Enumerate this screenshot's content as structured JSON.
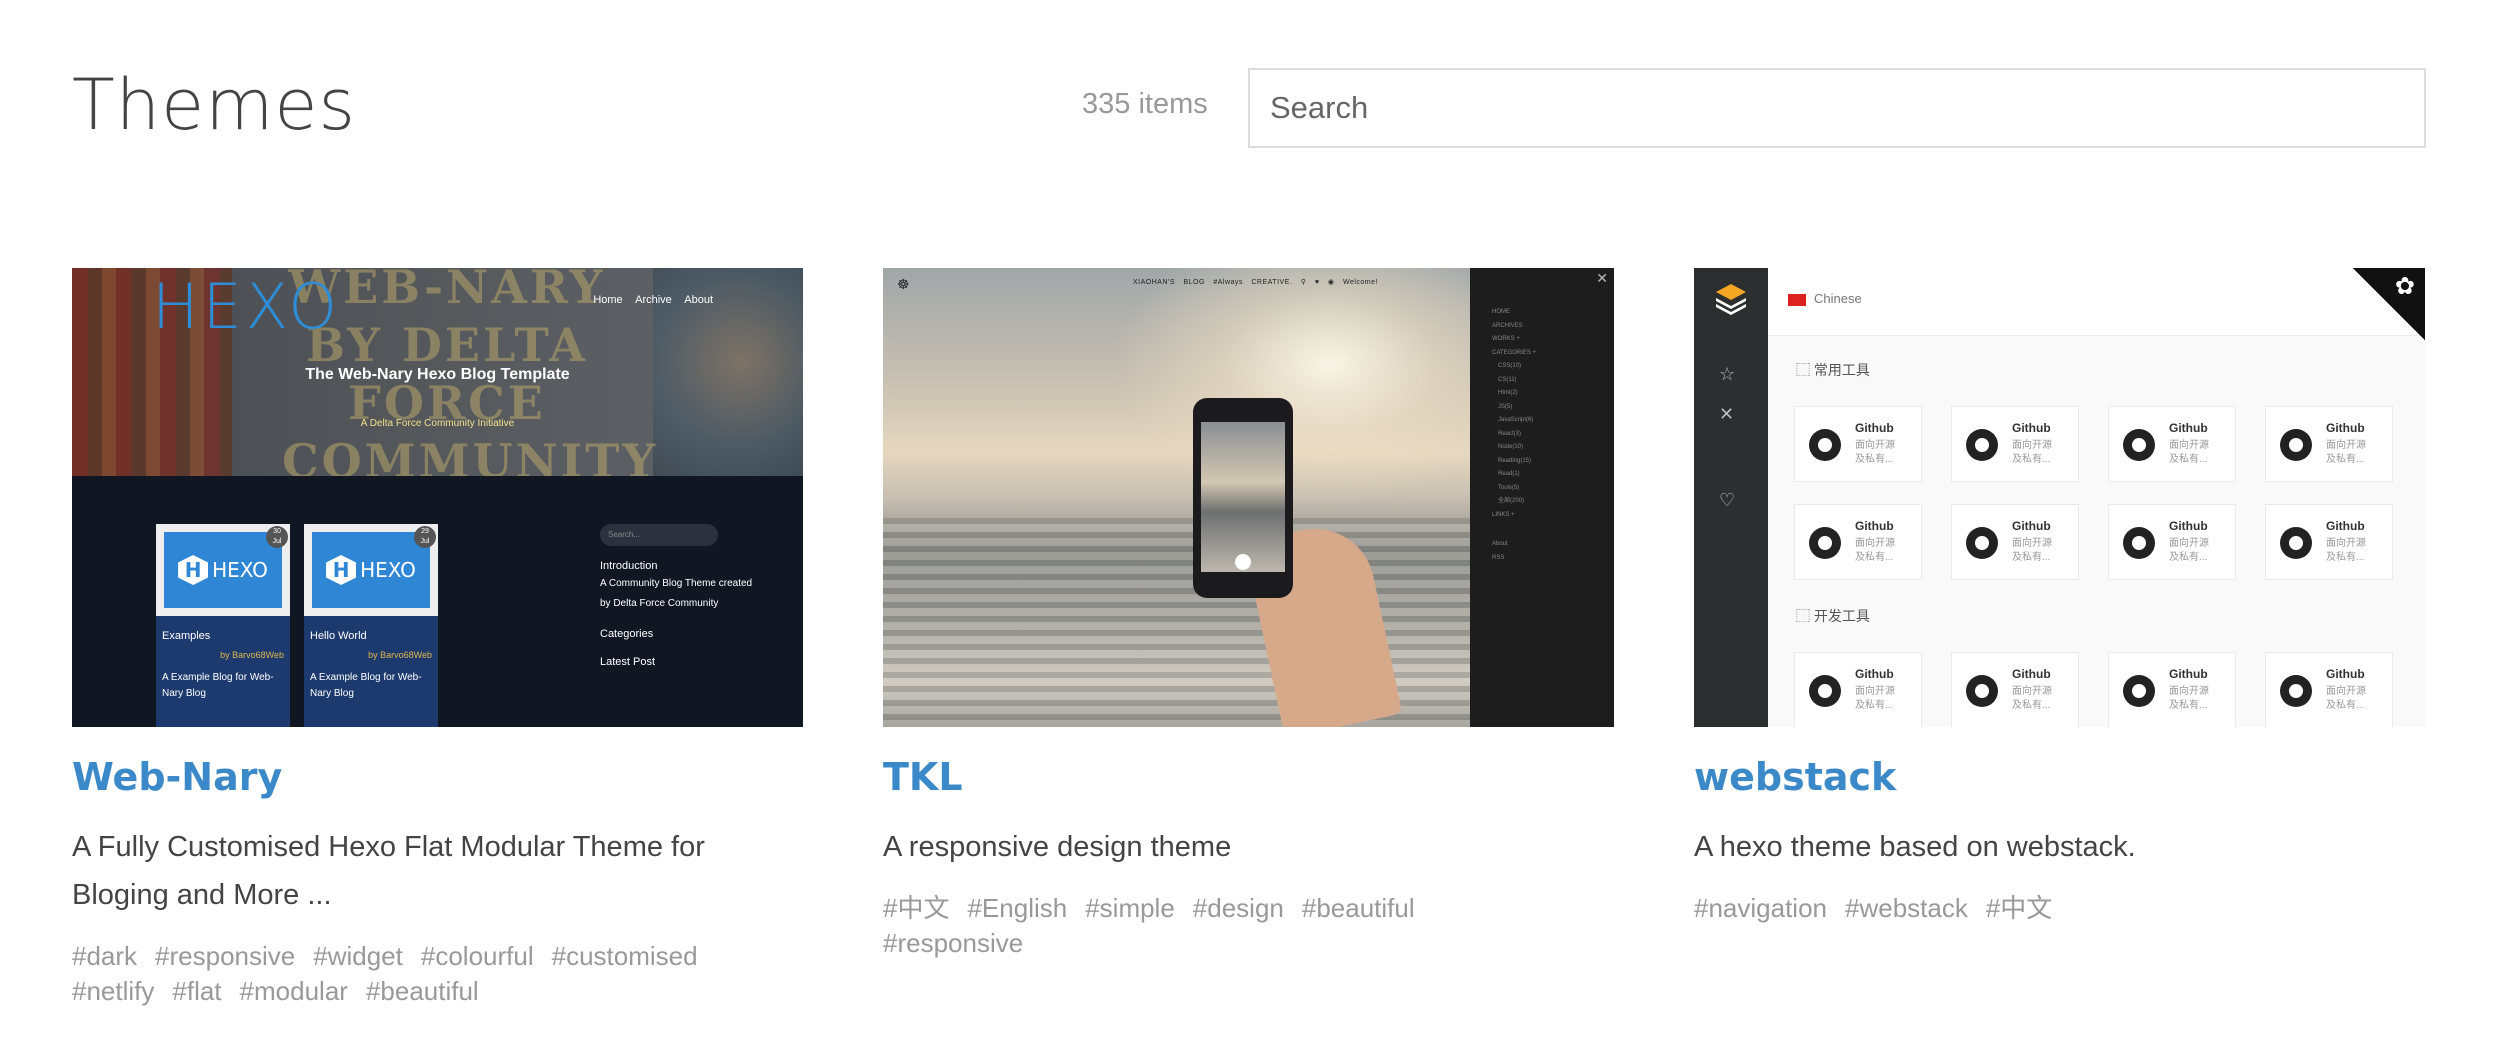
{
  "header": {
    "title": "Themes",
    "items_count": "335 items",
    "search_placeholder": "Search"
  },
  "themes": [
    {
      "name": "Web-Nary",
      "description": "A Fully Customised Hexo Flat Modular Theme for Bloging and More ...",
      "tags": [
        "#dark",
        "#responsive",
        "#widget",
        "#colourful",
        "#customised",
        "#netlify",
        "#flat",
        "#modular",
        "#beautiful"
      ],
      "preview": {
        "logo": "HEXO",
        "watermark": "WEB-NARY BY DELTA FORCE COMMUNITY",
        "nav": [
          "Home",
          "Archive",
          "About"
        ],
        "hero_title": "The Web-Nary Hexo Blog Template",
        "hero_sub": "A Delta Force Community Initiative",
        "posts": [
          {
            "logo": "HEXO",
            "date_day": "30",
            "date_month": "Jul",
            "title": "Examples",
            "by": "by Barvo68Web",
            "desc": "A Example Blog for Web-Nary Blog"
          },
          {
            "logo": "HEXO",
            "date_day": "29",
            "date_month": "Jul",
            "title": "Hello World",
            "by": "by Barvo68Web",
            "desc": "A Example Blog for Web-Nary Blog"
          }
        ],
        "sidebar": {
          "search": "Search...",
          "intro_heading": "Introduction",
          "intro_text": "A Community Blog Theme created by Delta Force Community",
          "categories": "Categories",
          "latest": "Latest Post"
        }
      }
    },
    {
      "name": "TKL",
      "description": "A responsive design theme",
      "tags": [
        "#中文",
        "#English",
        "#simple",
        "#design",
        "#beautiful",
        "#responsive"
      ],
      "preview": {
        "nav": "XIAOHAN'S BLOG   #Always CREATIVE.   ⚲   ♥   ◉   Welcome!",
        "menu": [
          "HOME",
          "ARCHIVES",
          "WORKS +",
          "CATEGORIES +",
          "CSS(10)",
          "CS(11)",
          "Html(2)",
          "JS(5)",
          "JavaScript(6)",
          "React(3)",
          "Node(10)",
          "Reading(15)",
          "Read(1)",
          "Tools(5)",
          "全部(200)",
          "LINKS +",
          "About",
          "RSS"
        ]
      }
    },
    {
      "name": "webstack",
      "description": "A hexo theme based on webstack.",
      "tags": [
        "#navigation",
        "#webstack",
        "#中文"
      ],
      "preview": {
        "language": "Chinese",
        "section_1": "常用工具",
        "section_2": "开发工具",
        "box_title": "Github",
        "box_desc_1": "面向开源",
        "box_desc_2": "及私有..."
      }
    }
  ],
  "colors": {
    "link": "#3c89c9",
    "tag": "#999999",
    "title": "#444444"
  }
}
